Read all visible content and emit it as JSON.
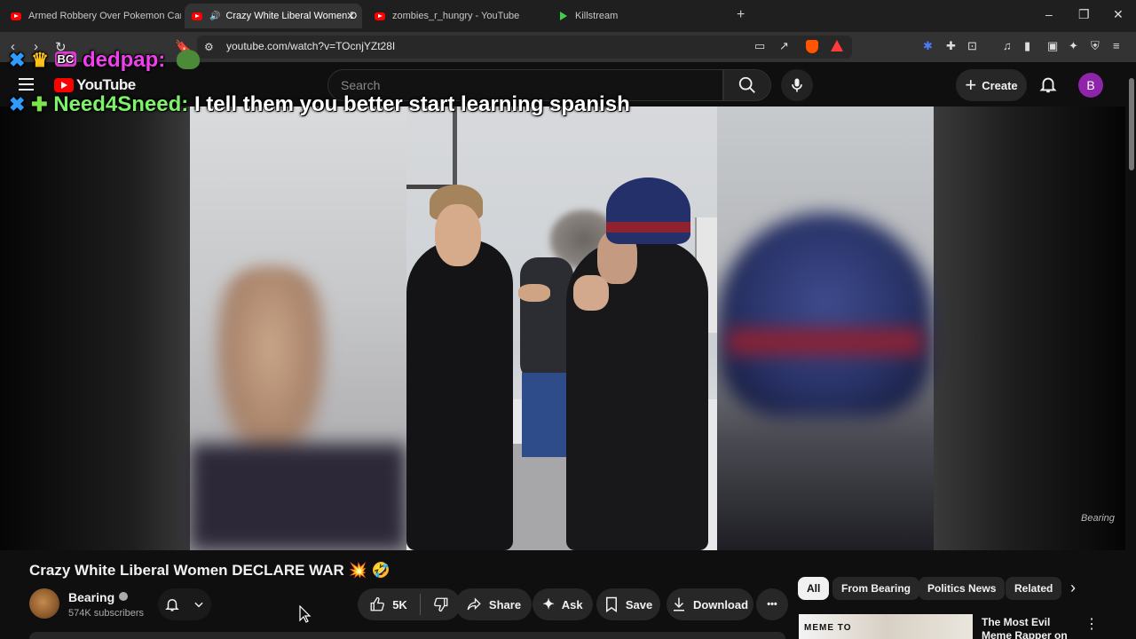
{
  "browser": {
    "tabs": [
      {
        "title": "Armed Robbery Over Pokemon Card",
        "active": false,
        "icon": "youtube-icon"
      },
      {
        "title": "Crazy White Liberal Women D",
        "active": true,
        "icon": "youtube-icon"
      },
      {
        "title": "zombies_r_hungry - YouTube",
        "active": false,
        "icon": "youtube-icon"
      },
      {
        "title": "Killstream",
        "active": false,
        "icon": "killstream-icon"
      }
    ],
    "new_tab": "+",
    "url": "youtube.com/watch?v=TOcnjYZt28I",
    "window_controls": [
      "–",
      "❐",
      "✕"
    ]
  },
  "youtube": {
    "logo_text": "YouTube",
    "search_placeholder": "Search",
    "create_label": "Create",
    "avatar_letter": "B"
  },
  "chat": [
    {
      "username": "dedpap:",
      "message": "",
      "name_color": "#f13ff0",
      "badges": [
        "sword-badge",
        "crown-badge",
        "bc-badge"
      ],
      "emote": "frog-emote"
    },
    {
      "username": "Need4Sneed:",
      "message": "I tell them you better start learning spanish",
      "name_color": "#7df36a",
      "badges": [
        "sword-badge",
        "gem-badge"
      ]
    }
  ],
  "chat_badge_bc": "BC",
  "video": {
    "watermark": "Bearing",
    "title": "Crazy White Liberal Women DECLARE WAR",
    "title_emojis": "💥 🤣"
  },
  "channel": {
    "name": "Bearing",
    "subscribers": "574K subscribers"
  },
  "actions": {
    "likes": "5K",
    "share": "Share",
    "ask": "Ask",
    "save": "Save",
    "download": "Download",
    "more": "•••"
  },
  "chips": [
    "All",
    "From Bearing",
    "Politics News",
    "Related"
  ],
  "recommendation": {
    "title": "The Most Evil Meme Rapper on the",
    "thumb_text": "MEME TO"
  },
  "colors": {
    "accent": "#ff0000",
    "avatar": "#8e24aa"
  }
}
